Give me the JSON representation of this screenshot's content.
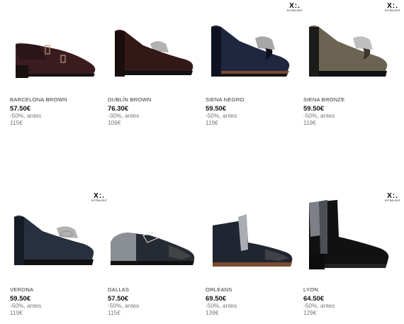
{
  "badge": {
    "mark": "X:.",
    "label": "EXTRALIGHT"
  },
  "products": [
    {
      "name": "BARCELONA BROWN",
      "price": "57.50€",
      "discount": "-50%, antes",
      "original": "115€",
      "color": "#3a1c20",
      "badge": false
    },
    {
      "name": "DUBLÍN BROWN",
      "price": "76.30€",
      "discount": "-30%, antes",
      "original": "109€",
      "color": "#341818",
      "badge": false
    },
    {
      "name": "SIENA NEGRO",
      "price": "59.50€",
      "discount": "-50%, antes",
      "original": "119€",
      "color": "#1e2640",
      "badge": true
    },
    {
      "name": "SIENA BRONZE",
      "price": "59.50€",
      "discount": "-50%, antes",
      "original": "119€",
      "color": "#6b6452",
      "badge": true
    },
    {
      "name": "VERONA",
      "price": "59.50€",
      "discount": "-50%, antes",
      "original": "119€",
      "color": "#27303f",
      "badge": true
    },
    {
      "name": "DALLAS",
      "price": "57.50€",
      "discount": "-50%, antes",
      "original": "115€",
      "color": "#262b33",
      "badge": false
    },
    {
      "name": "ORLEANS",
      "price": "69.50€",
      "discount": "-50%, antes",
      "original": "139€",
      "color": "#1f2531",
      "badge": false
    },
    {
      "name": "LYON",
      "price": "64.50€",
      "discount": "-50%, antes",
      "original": "129€",
      "color": "#111111",
      "badge": true
    }
  ]
}
